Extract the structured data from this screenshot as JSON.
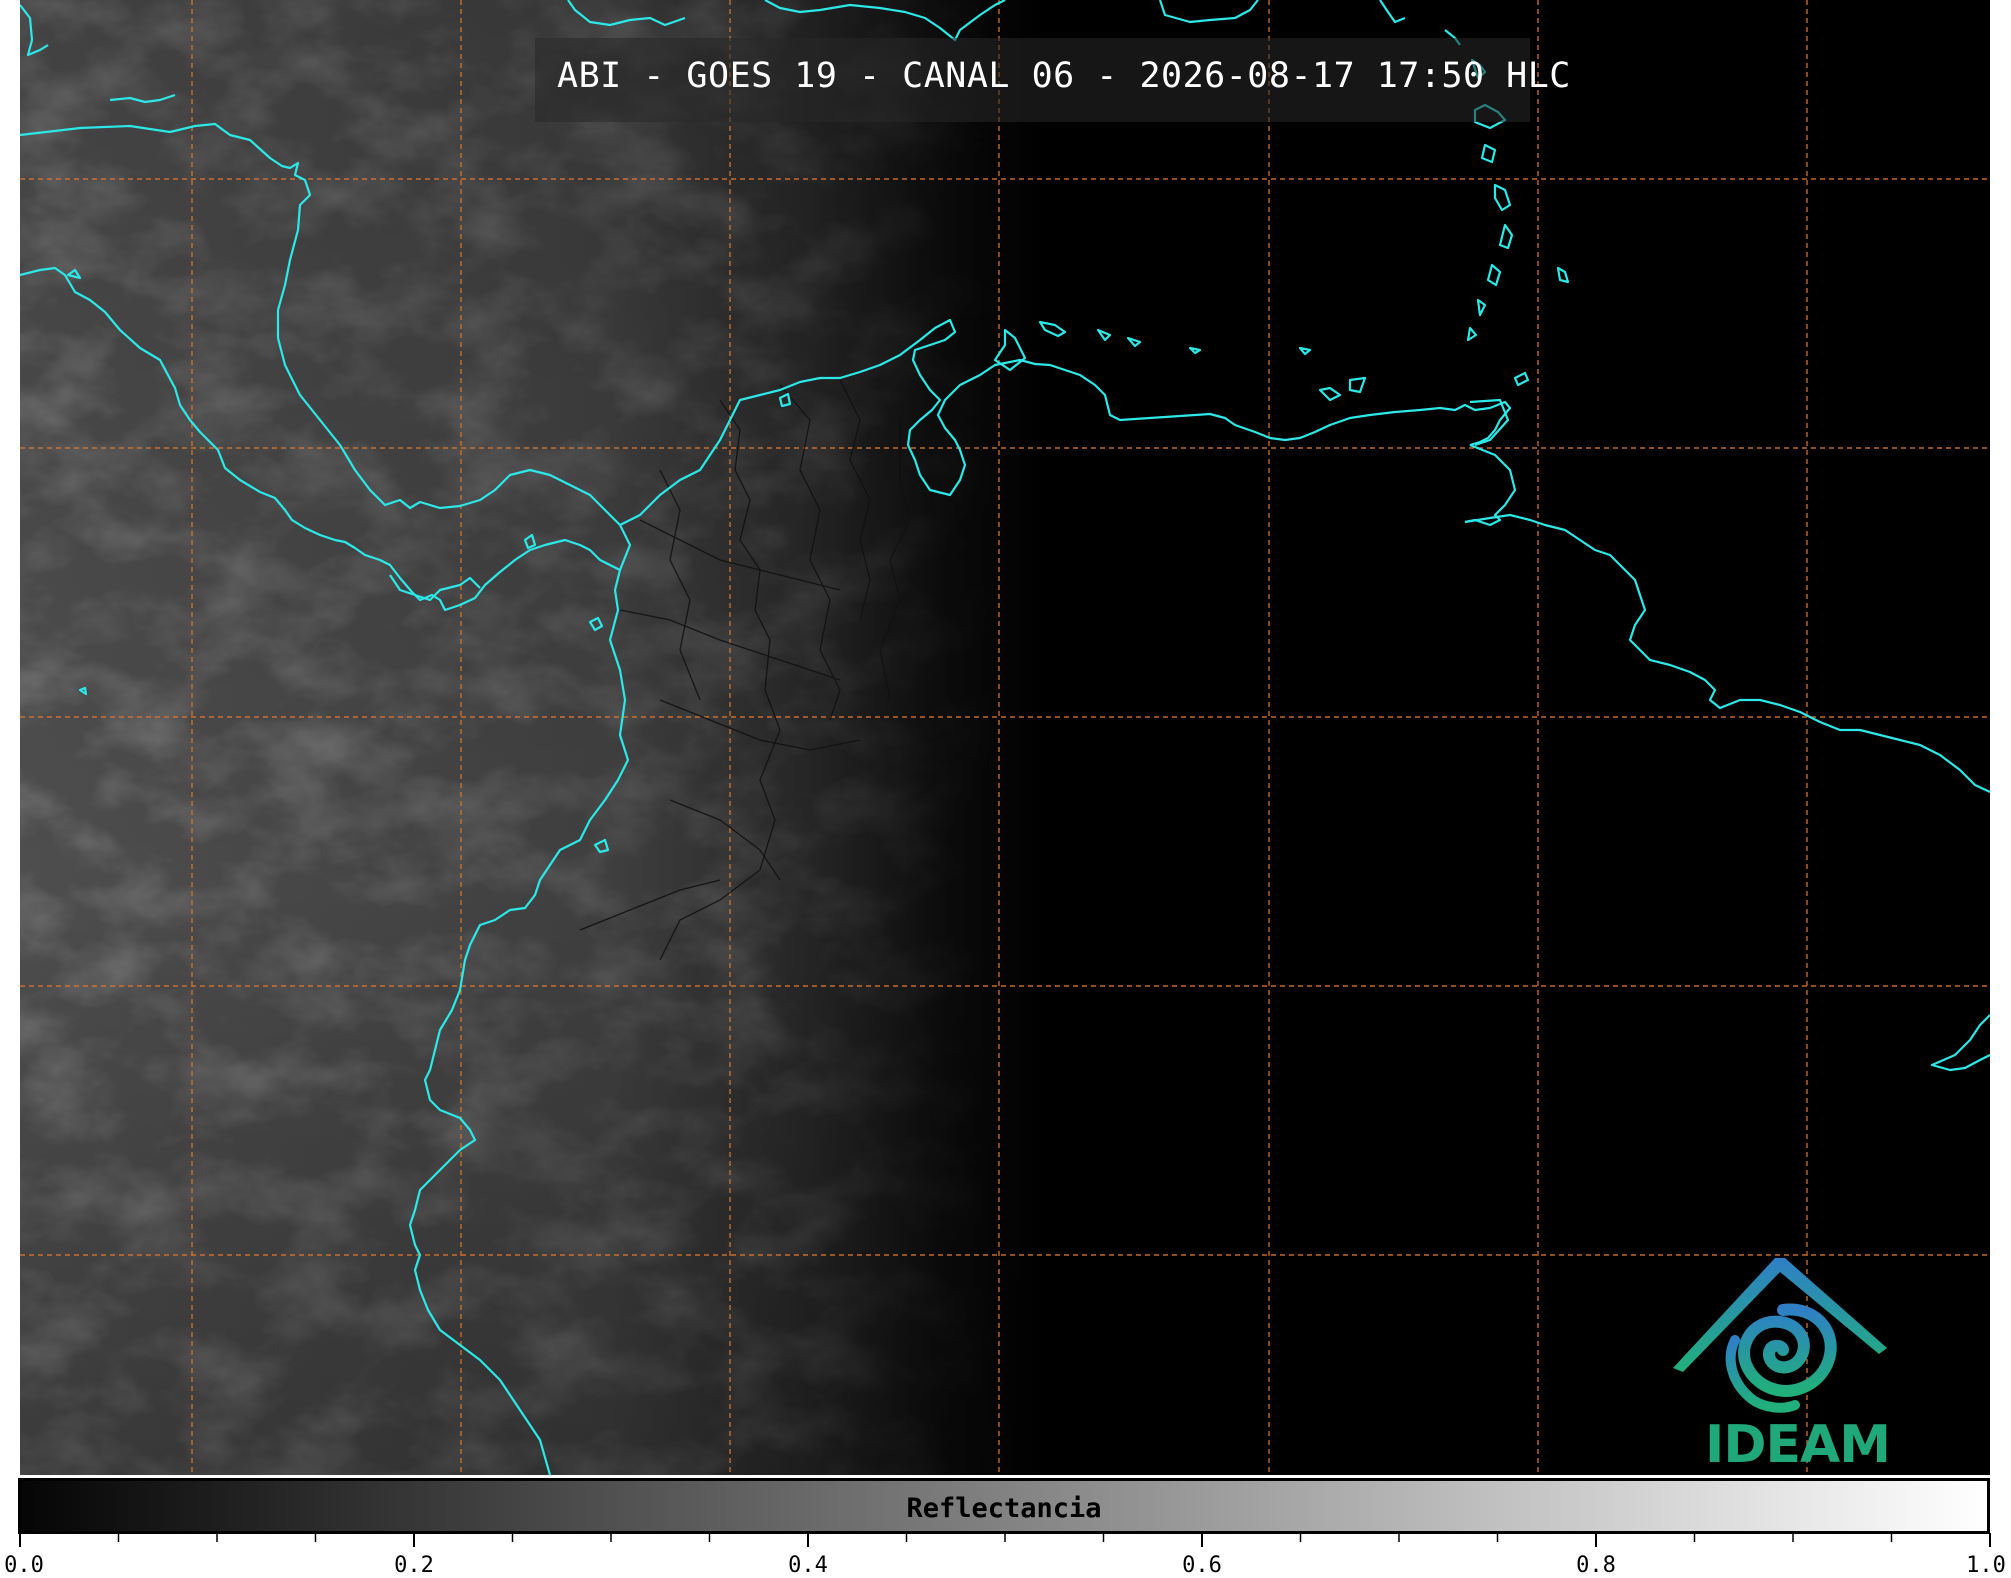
{
  "title": "ABI - GOES 19 - CANAL 06 - 2026-08-17 17:50 HLC",
  "colors": {
    "coastline": "#2de8e8",
    "graticule": "#d8742a",
    "borders": "#000000",
    "logo_text": "#21a87a",
    "logo_gradient": [
      "#2f7fc6",
      "#21b07a"
    ]
  },
  "colorbar": {
    "label": "Reflectancia",
    "ticks": [
      "0.0",
      "0.2",
      "0.4",
      "0.6",
      "0.8",
      "1.0"
    ],
    "range": [
      0.0,
      1.0
    ],
    "colormap": "gray"
  },
  "logo": {
    "text": "IDEAM",
    "icon": "ideam-logo-icon"
  }
}
